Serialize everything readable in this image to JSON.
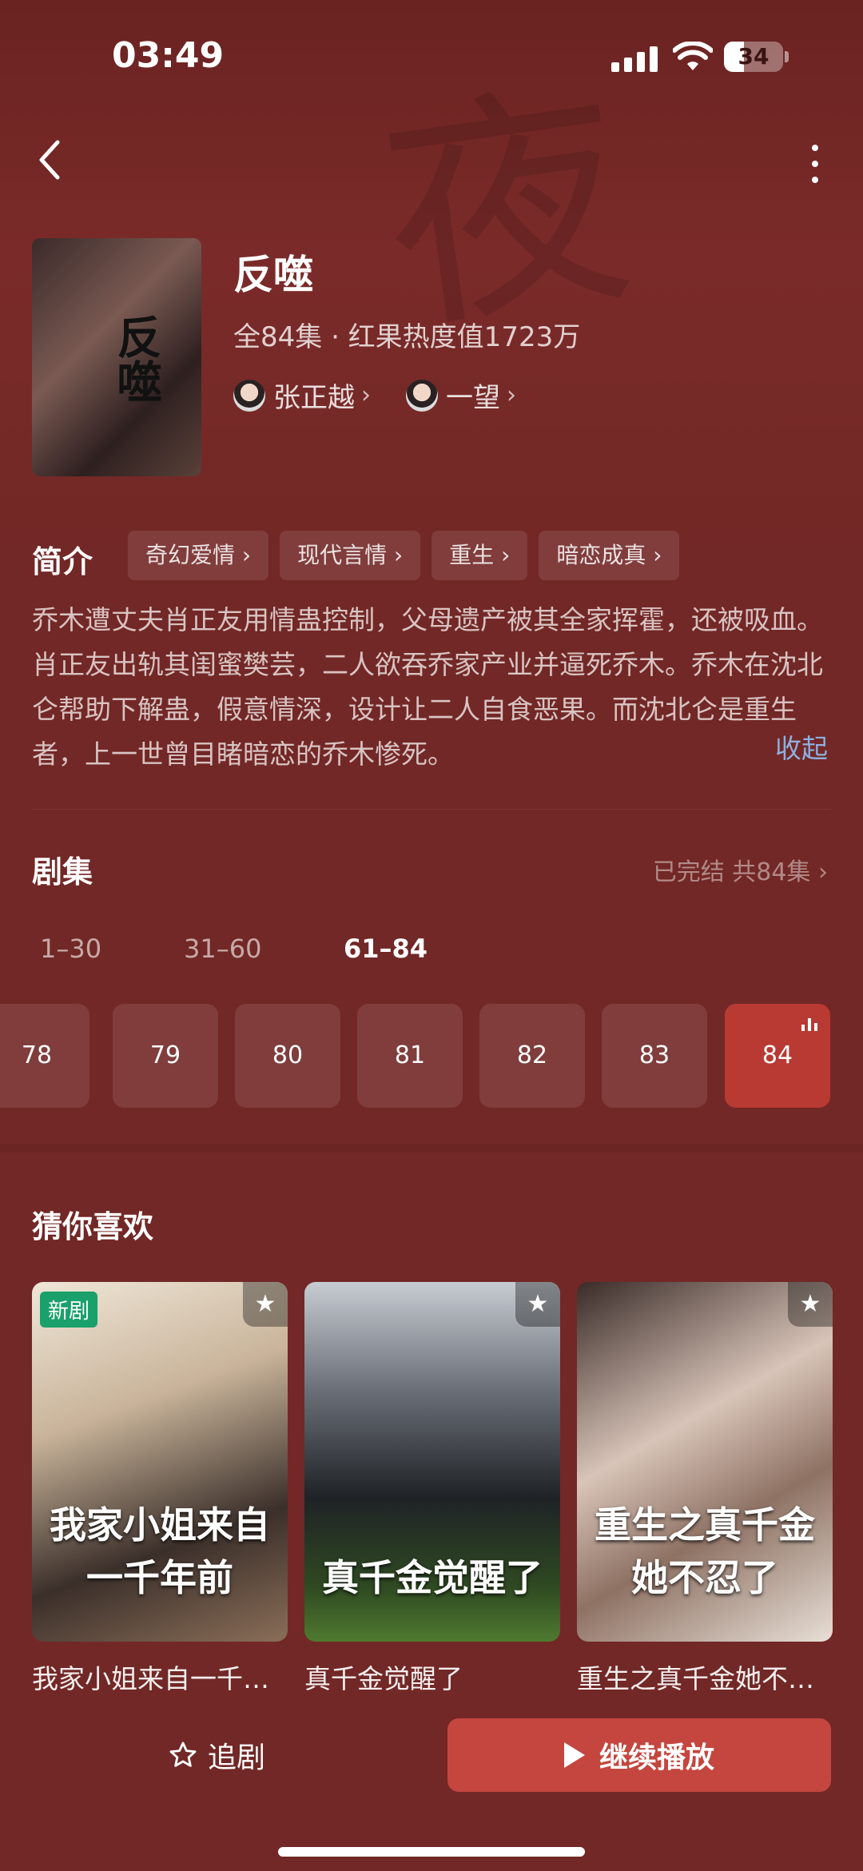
{
  "status_bar": {
    "time": "03:49",
    "battery": "34",
    "battery_level": 0.34
  },
  "show": {
    "title": "反噬",
    "meta": "全84集 · 红果热度值1723万",
    "cover_text": "反噬",
    "cast": [
      {
        "name": "张正越"
      },
      {
        "name": "一望"
      }
    ]
  },
  "intro": {
    "label": "简介",
    "tags": [
      "奇幻爱情 ›",
      "现代言情 ›",
      "重生 ›",
      "暗恋成真 ›"
    ],
    "synopsis": "乔木遭丈夫肖正友用情蛊控制，父母遗产被其全家挥霍，还被吸血。肖正友出轨其闺蜜樊芸，二人欲吞乔家产业并逼死乔木。乔木在沈北仑帮助下解蛊，假意情深，设计让二人自食恶果。而沈北仑是重生者，上一世曾目睹暗恋的乔木惨死。",
    "collapse": "收起"
  },
  "episodes": {
    "title": "剧集",
    "status": "已完结 共84集 ›",
    "ranges": [
      "1–30",
      "31–60",
      "61–84"
    ],
    "active_range": "61–84",
    "items": [
      "78",
      "79",
      "80",
      "81",
      "82",
      "83",
      "84"
    ],
    "active_item": "84"
  },
  "recommend": {
    "title": "猜你喜欢",
    "items": [
      {
        "name": "我家小姐来自一千…",
        "poster_text": "我家小姐来自一千年前",
        "badge": "新剧"
      },
      {
        "name": "真千金觉醒了",
        "poster_text": "真千金觉醒了",
        "badge": ""
      },
      {
        "name": "重生之真千金她不…",
        "poster_text": "重生之真千金她不忍了",
        "badge": ""
      }
    ]
  },
  "actions": {
    "follow": "追剧",
    "play": "继续播放"
  },
  "colors": {
    "background": "#722826",
    "accent": "#c4463f",
    "link": "#8fb0e0",
    "new_badge": "#1aa06b"
  }
}
